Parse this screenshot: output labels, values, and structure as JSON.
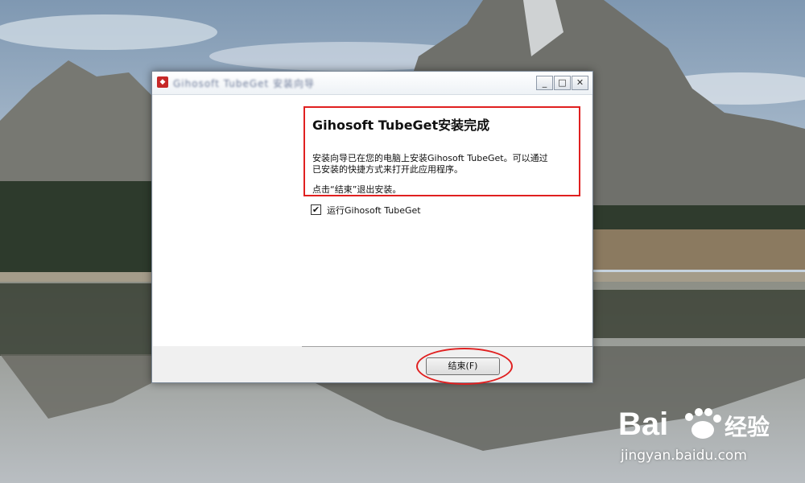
{
  "window": {
    "title": "Gihosoft TubeGet 安装向导",
    "icon": "installer-app-icon",
    "controls": {
      "minimize": "_",
      "maximize": "□",
      "close": "✕"
    }
  },
  "finish_page": {
    "heading": "Gihosoft TubeGet安装完成",
    "desc_line1": "安装向导已在您的电脑上安装Gihosoft TubeGet。可以通过",
    "desc_line2": "已安装的快捷方式来打开此应用程序。",
    "desc_line3": "点击“结束”退出安装。",
    "run_label": "运行Gihosoft TubeGet",
    "run_checked": "✔"
  },
  "buttons": {
    "finish": "结束(F)"
  },
  "watermark": {
    "brand": "Bai",
    "brand_cn": "经验",
    "url": "jingyan.baidu.com"
  },
  "colors": {
    "highlight": "#e02020",
    "window_bg": "#f0f0f0"
  }
}
